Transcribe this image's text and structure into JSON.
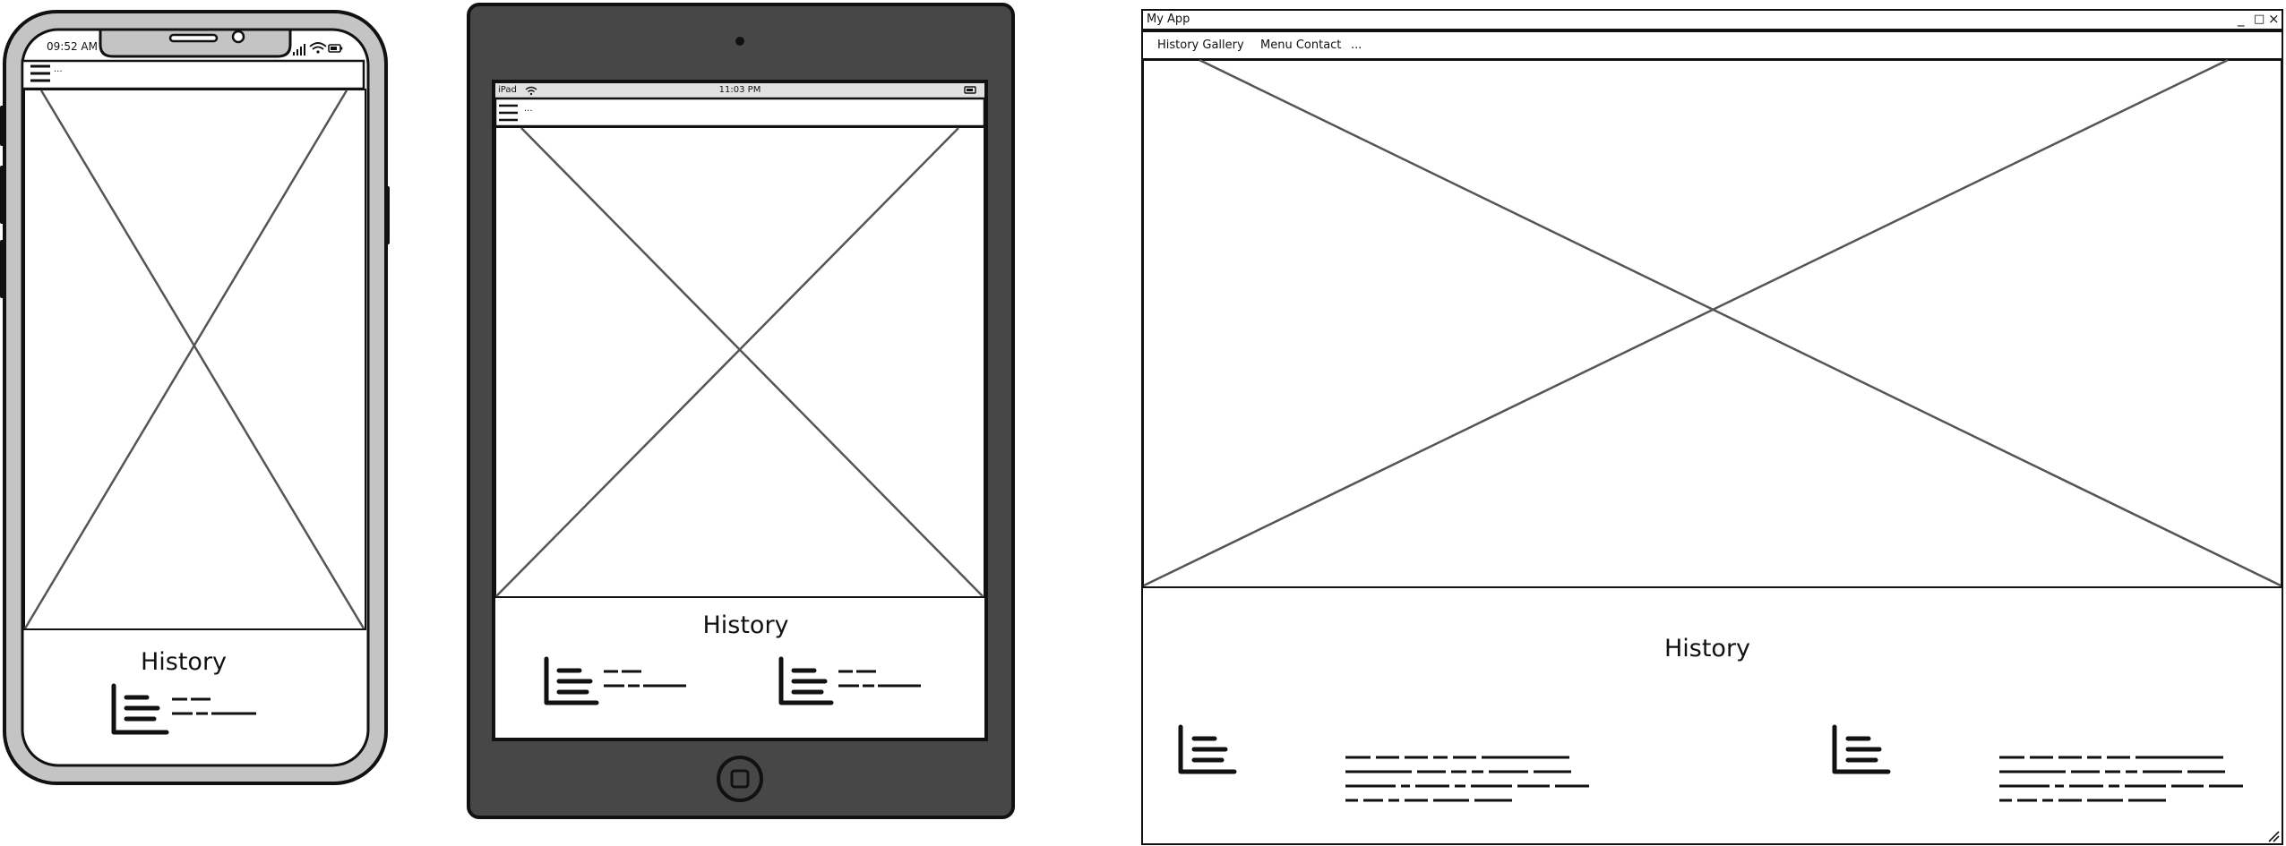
{
  "phone": {
    "status_time": "09:52 AM",
    "nav_hint": "...",
    "section_title": "History"
  },
  "tablet": {
    "status_carrier": "iPad",
    "status_time": "11:03 PM",
    "nav_hint": "...",
    "section_title": "History"
  },
  "desktop": {
    "window_title": "My App",
    "window_controls": {
      "minimize": "_",
      "maximize": "□",
      "close": "×"
    },
    "nav_items": [
      "History Gallery",
      "Menu Contact",
      "..."
    ],
    "section_title": "History"
  },
  "colors": {
    "outline": "#111111",
    "phone_shell": "#c4c4c4",
    "tablet_shell": "#474747",
    "placeholder_lines": "#555555"
  }
}
